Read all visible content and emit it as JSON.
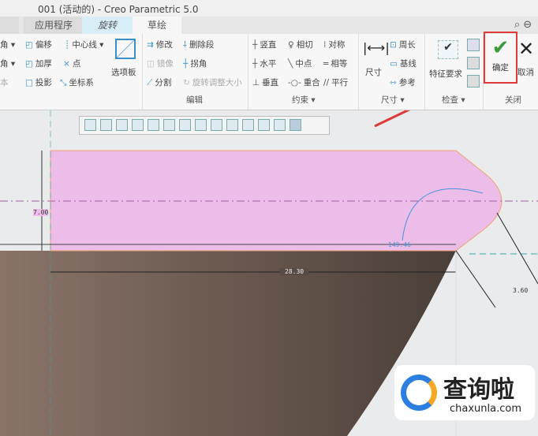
{
  "window": {
    "title": "001 (活动的) - Creo Parametric 5.0"
  },
  "tabs": [
    {
      "label": "应用程序"
    },
    {
      "label": "旋转"
    },
    {
      "label": "草绘"
    }
  ],
  "ribbon": {
    "sketch": {
      "items": [
        "角 ▾",
        "偏移",
        "中心线 ▾",
        "角 ▾",
        "加厚",
        "点",
        "本",
        "投影",
        "坐标系"
      ],
      "palette": "选项板"
    },
    "edit": {
      "items": [
        "修改",
        "删除段",
        "镜像",
        "拐角",
        "分割",
        "旋转调整大小"
      ],
      "label": "编辑"
    },
    "constrain": {
      "items": [
        "竖直",
        "相切",
        "对称",
        "水平",
        "中点",
        "相等",
        "垂直",
        "重合",
        "平行"
      ],
      "label": "约束 ▾"
    },
    "dimension": {
      "main": "尺寸",
      "items": [
        "周长",
        "基线",
        "参考"
      ],
      "label": "尺寸 ▾"
    },
    "inspect": {
      "main": "特征要求",
      "label": "检查 ▾"
    },
    "close": {
      "ok": "确定",
      "cancel": "取消",
      "label": "关闭"
    }
  },
  "dimensions": {
    "height": "7.00",
    "length": "28.30",
    "radius": "3.60",
    "angle": "149.46"
  },
  "watermark": {
    "brand": "查询啦",
    "url": "chaxunla.com"
  },
  "colors": {
    "sketch": "#ecbde9",
    "accent": "#3a8fc9",
    "highlight": "#e03a3a"
  }
}
